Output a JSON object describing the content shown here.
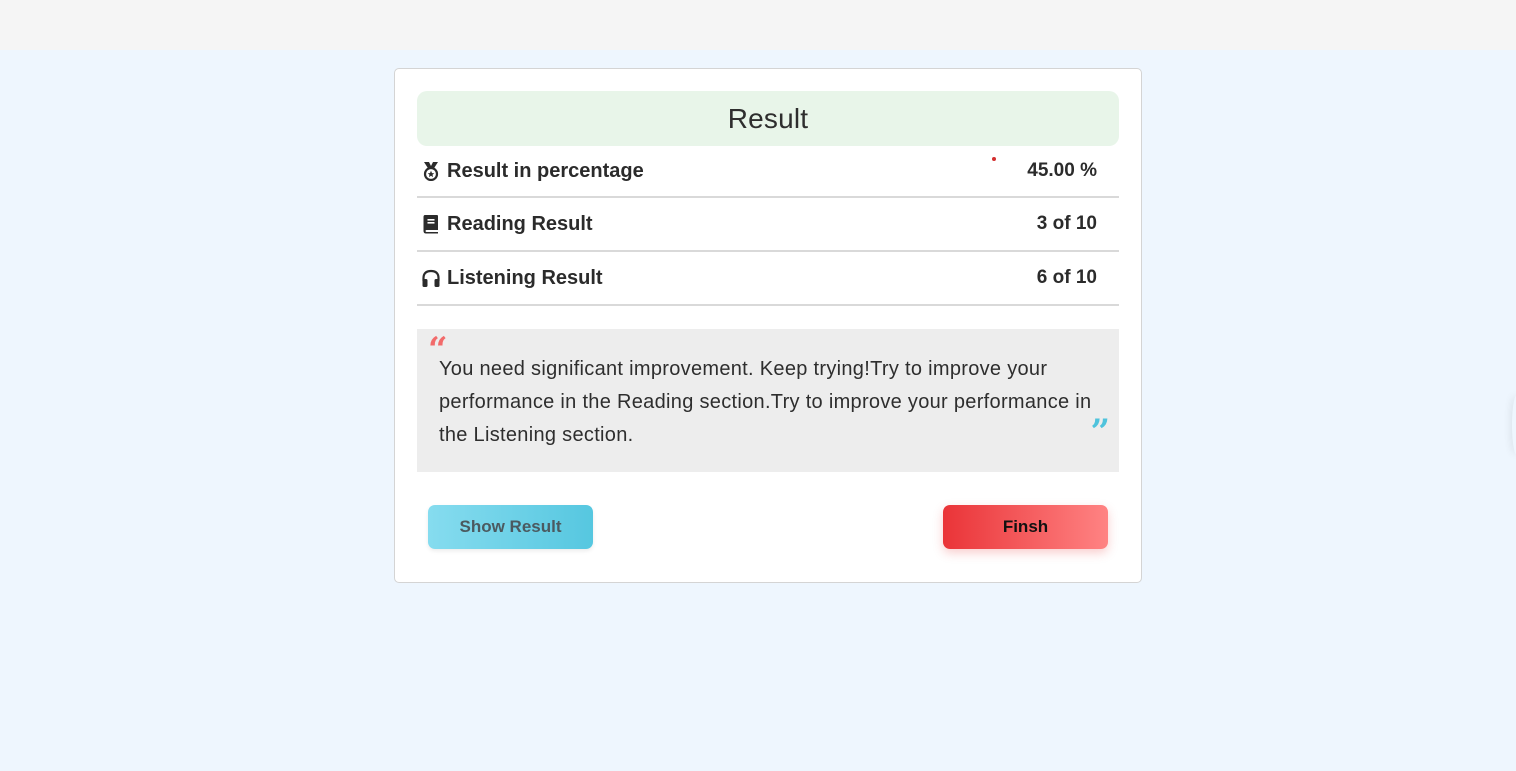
{
  "header": {
    "title": "Result"
  },
  "rows": [
    {
      "icon": "medal-icon",
      "label": "Result in percentage",
      "value": "45.00 %"
    },
    {
      "icon": "book-icon",
      "label": "Reading Result",
      "value": "3 of 10"
    },
    {
      "icon": "headphones-icon",
      "label": "Listening Result",
      "value": "6 of 10"
    }
  ],
  "feedback": {
    "open_quote": "“",
    "close_quote": "”",
    "text": "You need significant improvement. Keep trying!Try to improve your performance in the Reading section.Try to improve your performance in the Listening section."
  },
  "buttons": {
    "show_result": "Show Result",
    "finish": "Finsh"
  },
  "colors": {
    "page_background": "#eef6fe",
    "header_background": "#e8f5e9",
    "quote_open": "#f26b6b",
    "quote_close": "#4fc3dc",
    "show_button": "#56c7e0",
    "finish_button": "#ea3438"
  }
}
